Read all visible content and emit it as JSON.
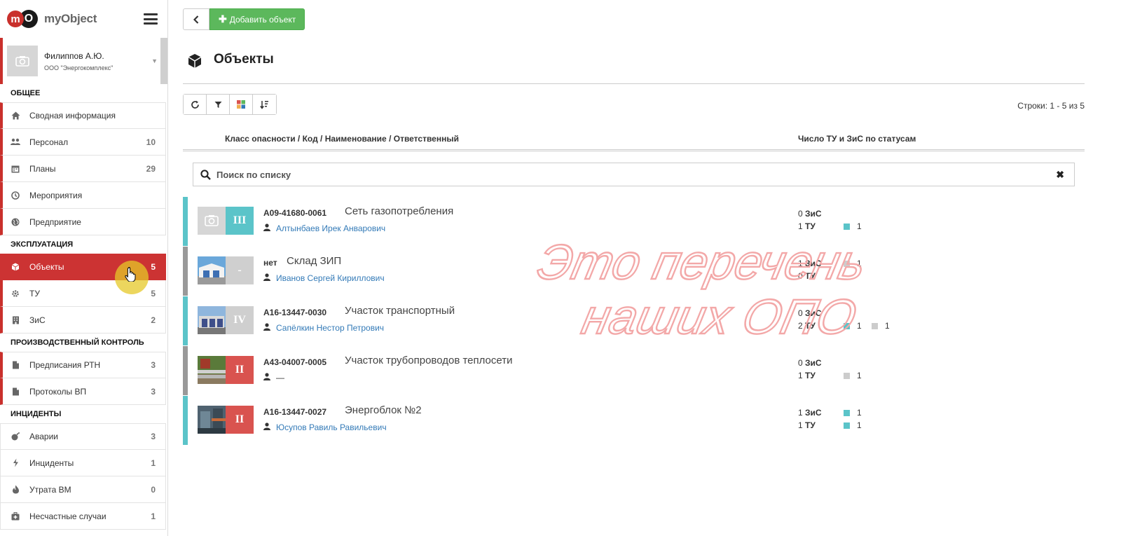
{
  "app": {
    "logo_m": "m",
    "logo_o": "O",
    "name": "myObject"
  },
  "user": {
    "name": "Филиппов А.Ю.",
    "org": "ООО \"Энергокомплекс\""
  },
  "sidebar": {
    "sections": [
      {
        "title": "ОБЩЕЕ",
        "items": [
          {
            "label": "Сводная информация",
            "count": "",
            "icon": "home-icon"
          },
          {
            "label": "Персонал",
            "count": "10",
            "icon": "users-icon"
          },
          {
            "label": "Планы",
            "count": "29",
            "icon": "calendar-icon"
          },
          {
            "label": "Мероприятия",
            "count": "",
            "icon": "clock-icon"
          },
          {
            "label": "Предприятие",
            "count": "",
            "icon": "globe-icon"
          }
        ]
      },
      {
        "title": "ЭКСПЛУАТАЦИЯ",
        "items": [
          {
            "label": "Объекты",
            "count": "5",
            "icon": "cube-icon",
            "active": true
          },
          {
            "label": "ТУ",
            "count": "5",
            "icon": "gear-icon"
          },
          {
            "label": "ЗиС",
            "count": "2",
            "icon": "building-icon"
          }
        ]
      },
      {
        "title": "ПРОИЗВОДСТВЕННЫЙ КОНТРОЛЬ",
        "items": [
          {
            "label": "Предписания РТН",
            "count": "3",
            "icon": "file-icon"
          },
          {
            "label": "Протоколы ВП",
            "count": "3",
            "icon": "file-icon"
          }
        ]
      },
      {
        "title": "ИНЦИДЕНТЫ",
        "items": [
          {
            "label": "Аварии",
            "count": "3",
            "icon": "bomb-icon"
          },
          {
            "label": "Инциденты",
            "count": "1",
            "icon": "bolt-icon"
          },
          {
            "label": "Утрата ВМ",
            "count": "0",
            "icon": "fire-icon"
          },
          {
            "label": "Несчастные случаи",
            "count": "1",
            "icon": "medkit-icon"
          }
        ]
      }
    ]
  },
  "toolbar": {
    "back_label": "",
    "add_label": "Добавить объект"
  },
  "page": {
    "title": "Объекты",
    "rows_info": "Строки: 1 - 5 из 5"
  },
  "table": {
    "col1": "Класс опасности / Код / Наименование / Ответственный",
    "col2": "Число ТУ и ЗиС по статусам"
  },
  "search": {
    "placeholder": "Поиск по списку",
    "value": "",
    "clear": "✖"
  },
  "colors": {
    "accent": "#cc3333",
    "green": "#5cb85c",
    "teal": "#5bc4c9",
    "grey": "#999999",
    "class_red": "#d9534f",
    "class_gray": "#cfcfcf",
    "status_teal": "#5bc4c9",
    "status_gray": "#cccccc",
    "link": "#337ab7"
  },
  "objects": [
    {
      "code": "А09-41680-0061",
      "name": "Сеть газопотребления",
      "responsible": "Алтынбаев Ирек Анварович",
      "hazard_class": "III",
      "class_color": "#5bc4c9",
      "row_color": "#5bc4c9",
      "thumb": "camera-placeholder",
      "zis": {
        "count": "0",
        "label": "ЗиС",
        "marks": []
      },
      "tu": {
        "count": "1",
        "label": "ТУ",
        "marks": [
          {
            "color": "#5bc4c9",
            "n": "1"
          }
        ]
      }
    },
    {
      "code": "нет",
      "name": "Склад ЗИП",
      "responsible": "Иванов Сергей Кириллович",
      "hazard_class": "-",
      "class_color": "#cfcfcf",
      "row_color": "#999999",
      "thumb": "warehouse-photo",
      "zis": {
        "count": "1",
        "label": "ЗиС",
        "marks": [
          {
            "color": "#cccccc",
            "n": "1"
          }
        ]
      },
      "tu": {
        "count": "0",
        "label": "ТУ",
        "marks": []
      }
    },
    {
      "code": "А16-13447-0030",
      "name": "Участок транспортный",
      "responsible": "Сапёлкин Нестор Петрович",
      "hazard_class": "IV",
      "class_color": "#cfcfcf",
      "row_color": "#5bc4c9",
      "thumb": "garage-photo",
      "zis": {
        "count": "0",
        "label": "ЗиС",
        "marks": []
      },
      "tu": {
        "count": "2",
        "label": "ТУ",
        "marks": [
          {
            "color": "#5bc4c9",
            "n": "1"
          },
          {
            "color": "#cccccc",
            "n": "1"
          }
        ]
      }
    },
    {
      "code": "А43-04007-0005",
      "name": "Участок трубопроводов теплосети",
      "responsible": "—",
      "hazard_class": "II",
      "class_color": "#d9534f",
      "row_color": "#999999",
      "thumb": "pipeline-photo",
      "zis": {
        "count": "0",
        "label": "ЗиС",
        "marks": []
      },
      "tu": {
        "count": "1",
        "label": "ТУ",
        "marks": [
          {
            "color": "#cccccc",
            "n": "1"
          }
        ]
      }
    },
    {
      "code": "А16-13447-0027",
      "name": "Энергоблок №2",
      "responsible": "Юсупов Равиль Равильевич",
      "hazard_class": "II",
      "class_color": "#d9534f",
      "row_color": "#5bc4c9",
      "thumb": "equipment-photo",
      "zis": {
        "count": "1",
        "label": "ЗиС",
        "marks": [
          {
            "color": "#5bc4c9",
            "n": "1"
          }
        ]
      },
      "tu": {
        "count": "1",
        "label": "ТУ",
        "marks": [
          {
            "color": "#5bc4c9",
            "n": "1"
          }
        ]
      }
    }
  ],
  "watermark": {
    "line1": "Это перечень",
    "line2": "наших ОПО"
  }
}
